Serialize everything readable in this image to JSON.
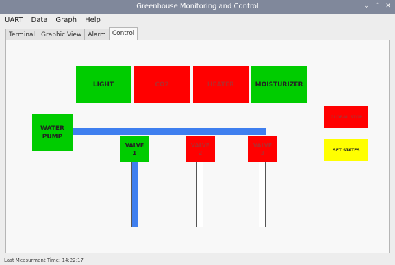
{
  "window": {
    "title": "Greenhouse Monitoring and Control",
    "controls": [
      "⌄",
      "˄",
      "✕"
    ]
  },
  "menu": [
    "UART",
    "Data",
    "Graph",
    "Help"
  ],
  "tabs": [
    {
      "label": "Terminal",
      "active": false
    },
    {
      "label": "Graphic View",
      "active": false
    },
    {
      "label": "Alarm",
      "active": false
    },
    {
      "label": "Control",
      "active": true
    }
  ],
  "control": {
    "devices": [
      {
        "label": "LIGHT",
        "state": "on"
      },
      {
        "label": "CO2",
        "state": "off"
      },
      {
        "label": "HEATER",
        "state": "off"
      },
      {
        "label": "MOISTURIZER",
        "state": "on"
      }
    ],
    "pump": {
      "label": "WATER PUMP",
      "state": "on"
    },
    "valves": [
      {
        "label": "VALVE 1",
        "state": "on"
      },
      {
        "label": "VALVE 2",
        "state": "off"
      },
      {
        "label": "VALVE 3",
        "state": "off"
      }
    ],
    "global_stop_label": "GLOBAL STOP",
    "set_states_label": "SET STATES"
  },
  "status": {
    "text": "Last Measurment Time: 14:22:17"
  },
  "colors": {
    "on": "#00cc00",
    "off": "#ff0000",
    "pipe_active": "#3f7fef",
    "set_states": "#ffff00"
  }
}
